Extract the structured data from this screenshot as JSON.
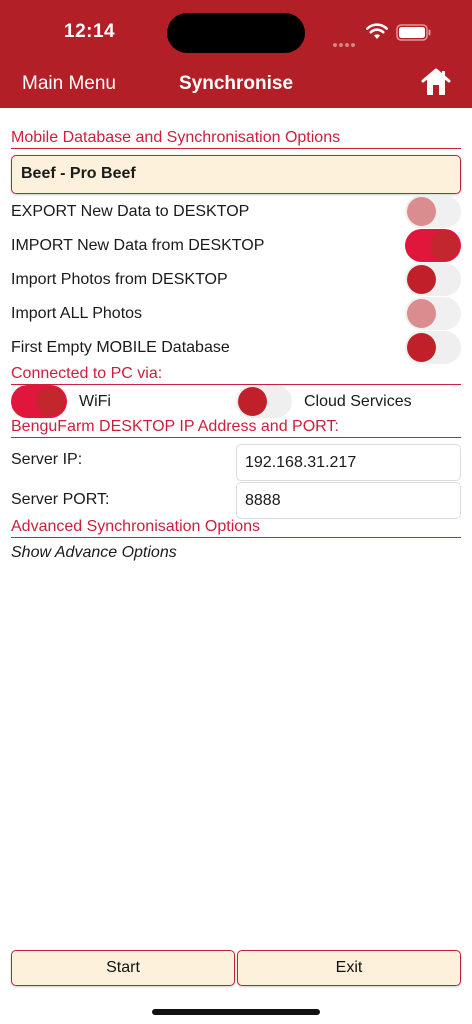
{
  "status": {
    "time": "12:14"
  },
  "nav": {
    "back_label": "Main Menu",
    "title": "Synchronise"
  },
  "sections": {
    "options": "Mobile Database and Synchronisation Options",
    "connected": "Connected to PC via:",
    "ip_header": "BenguFarm DESKTOP IP Address and PORT:",
    "advanced": "Advanced Synchronisation Options"
  },
  "database": {
    "selected": "Beef - Pro Beef"
  },
  "toggles": [
    {
      "label": "EXPORT New Data to DESKTOP",
      "state": "off",
      "enabled": false
    },
    {
      "label": "IMPORT New Data from DESKTOP",
      "state": "on",
      "enabled": true
    },
    {
      "label": "Import Photos from DESKTOP",
      "state": "off",
      "enabled": true
    },
    {
      "label": "Import ALL Photos",
      "state": "off",
      "enabled": false
    },
    {
      "label": "First Empty MOBILE Database",
      "state": "off",
      "enabled": true
    }
  ],
  "connection": {
    "wifi_label": "WiFi",
    "wifi_state": "on",
    "cloud_label": "Cloud Services",
    "cloud_state": "off"
  },
  "server": {
    "ip_label": "Server IP:",
    "ip_value": "192.168.31.217",
    "port_label": "Server PORT:",
    "port_value": "8888"
  },
  "advanced": {
    "link_label": "Show Advance Options"
  },
  "buttons": {
    "start": "Start",
    "exit": "Exit"
  },
  "colors": {
    "header": "#b31f26",
    "accent": "#cc1f3c",
    "button_bg": "#fdf1dc",
    "toggle_on": "#e0163c"
  }
}
